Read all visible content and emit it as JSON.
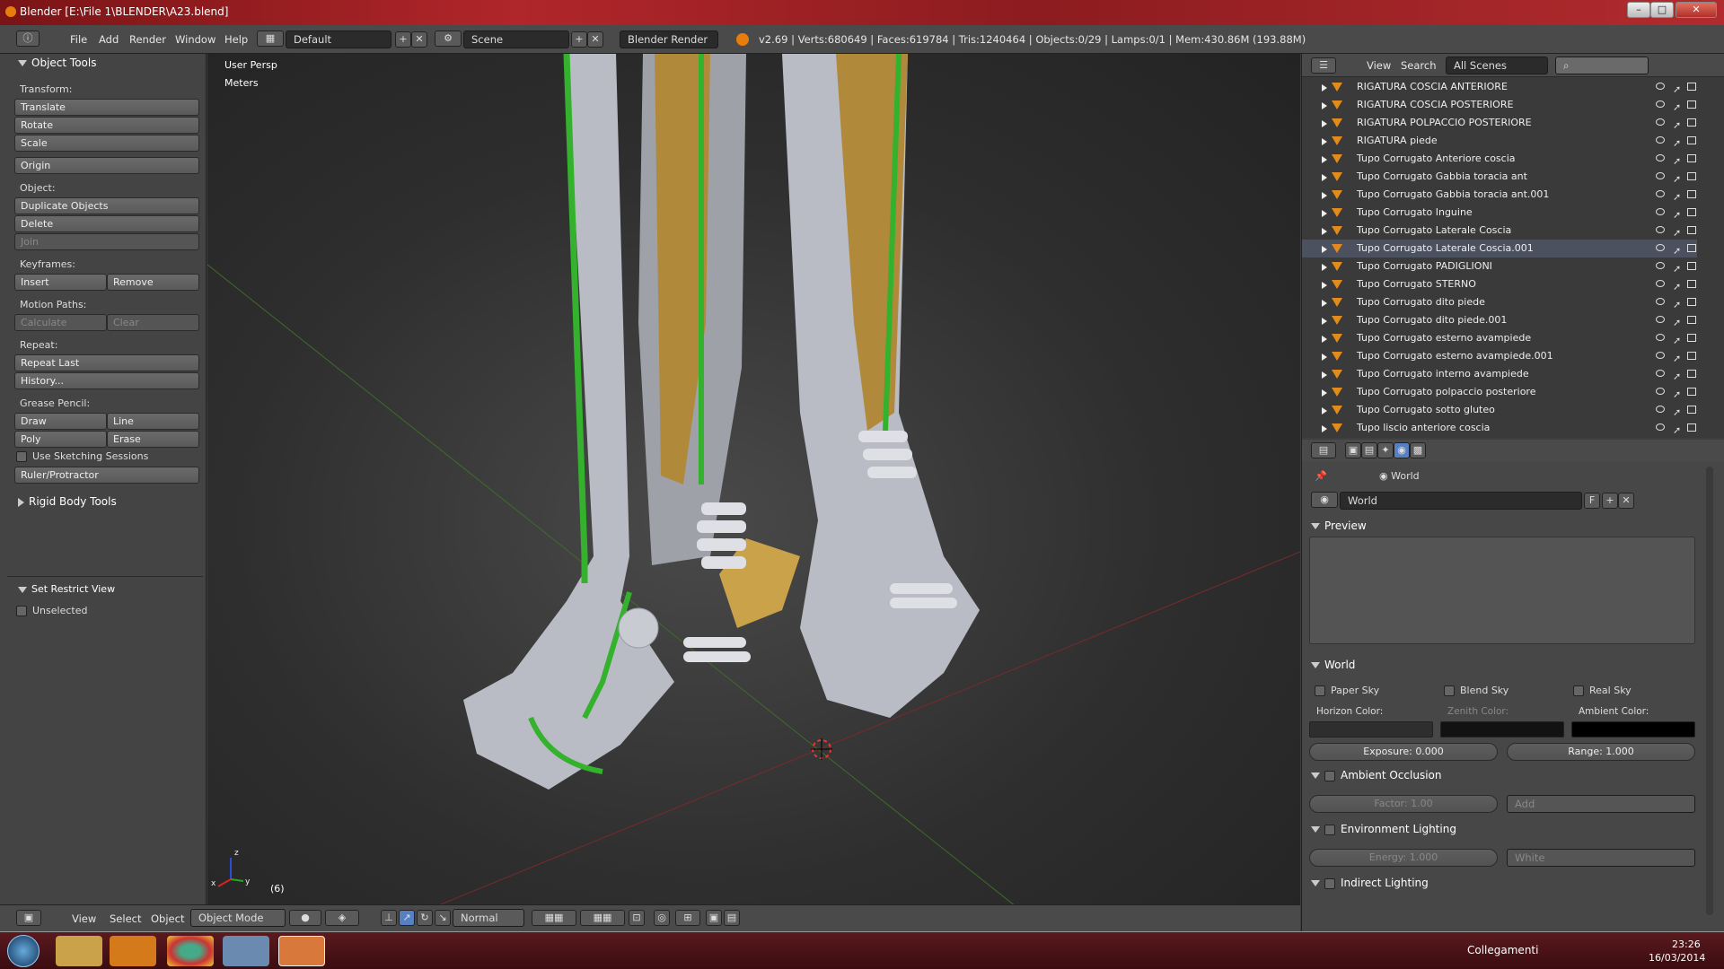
{
  "window": {
    "title": "Blender [E:\\File 1\\BLENDER\\A23.blend]",
    "minimize": "–",
    "maximize": "□",
    "close": "✕"
  },
  "header": {
    "menus": [
      "File",
      "Add",
      "Render",
      "Window",
      "Help"
    ],
    "screen_layout": "Default",
    "scene": "Scene",
    "render_engine": "Blender Render",
    "stats": "v2.69 | Verts:680649 | Faces:619784 | Tris:1240464 | Objects:0/29 | Lamps:0/1 | Mem:430.86M (193.88M)"
  },
  "tool_shelf": {
    "title": "Object Tools",
    "transform_label": "Transform:",
    "translate": "Translate",
    "rotate": "Rotate",
    "scale": "Scale",
    "origin": "Origin",
    "object_label": "Object:",
    "duplicate": "Duplicate Objects",
    "delete": "Delete",
    "join": "Join",
    "keyframes_label": "Keyframes:",
    "insert": "Insert",
    "remove": "Remove",
    "motion_paths_label": "Motion Paths:",
    "calculate": "Calculate",
    "clear": "Clear",
    "repeat_label": "Repeat:",
    "repeat_last": "Repeat Last",
    "history": "History...",
    "grease_label": "Grease Pencil:",
    "draw": "Draw",
    "line": "Line",
    "poly": "Poly",
    "erase": "Erase",
    "sketching": "Use Sketching Sessions",
    "ruler": "Ruler/Protractor",
    "rigid_body": "Rigid Body Tools",
    "restrict_view": "Set Restrict View",
    "unselected": "Unselected"
  },
  "viewport": {
    "view_name": "User Persp",
    "units": "Meters",
    "frame": "(6)",
    "axis_x": "x",
    "axis_y": "y",
    "axis_z": "z"
  },
  "viewport_header": {
    "view": "View",
    "select": "Select",
    "object": "Object",
    "mode": "Object Mode",
    "pivot": "Normal"
  },
  "outliner": {
    "view": "View",
    "search": "Search",
    "filter": "All Scenes",
    "items": [
      "RIGATURA  COSCIA ANTERIORE",
      "RIGATURA  COSCIA POSTERIORE",
      "RIGATURA  POLPACCIO POSTERIORE",
      "RIGATURA  piede",
      "Tupo Corrugato Anteriore coscia",
      "Tupo Corrugato Gabbia toracia ant",
      "Tupo Corrugato Gabbia toracia ant.001",
      "Tupo Corrugato Inguine",
      "Tupo Corrugato Laterale Coscia",
      "Tupo Corrugato Laterale Coscia.001",
      "Tupo Corrugato PADIGLIONI",
      "Tupo Corrugato STERNO",
      "Tupo Corrugato dito piede",
      "Tupo Corrugato dito piede.001",
      "Tupo Corrugato esterno avampiede",
      "Tupo Corrugato esterno avampiede.001",
      "Tupo Corrugato interno avampiede",
      "Tupo Corrugato polpaccio posteriore",
      "Tupo Corrugato sotto gluteo",
      "Tupo liscio anteriore coscia"
    ]
  },
  "properties": {
    "breadcrumb": "World",
    "world_name": "World",
    "world_f": "F",
    "preview": "Preview",
    "world_section": "World",
    "paper_sky": "Paper Sky",
    "blend_sky": "Blend Sky",
    "real_sky": "Real Sky",
    "horizon_color": "Horizon Color:",
    "zenith_color": "Zenith Color:",
    "ambient_color": "Ambient Color:",
    "exposure": "Exposure: 0.000",
    "range": "Range: 1.000",
    "ao": "Ambient Occlusion",
    "ao_factor": "Factor: 1.00",
    "ao_mode": "Add",
    "env_light": "Environment Lighting",
    "env_energy": "Energy: 1.000",
    "env_color": "White",
    "indirect": "Indirect Lighting",
    "colors": {
      "horizon": "#2e2e2e",
      "zenith": "#121212",
      "ambient": "#000000"
    }
  },
  "taskbar": {
    "tray_label": "Collegamenti",
    "time": "23:26",
    "date": "16/03/2014"
  }
}
